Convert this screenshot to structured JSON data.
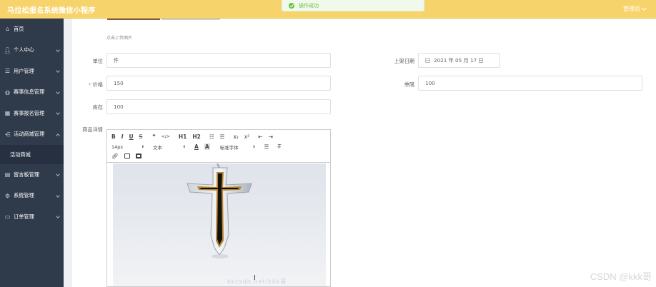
{
  "app": {
    "title": "马拉松报名系统微信小程序",
    "admin": "管理员"
  },
  "toast": {
    "message": "操作成功",
    "color": "#67c23a"
  },
  "colors": {
    "topbar": "#f7d46b",
    "sidebar": "#2f3a4a",
    "accent_red": "#f56c6c"
  },
  "sidebar": {
    "items": [
      {
        "label": "首页",
        "icon": "home-icon",
        "has_children": false
      },
      {
        "label": "个人中心",
        "icon": "user-icon",
        "has_children": true
      },
      {
        "label": "用户管理",
        "icon": "users-icon",
        "has_children": true
      },
      {
        "label": "赛事信息管理",
        "icon": "globe-icon",
        "has_children": true
      },
      {
        "label": "赛事报名管理",
        "icon": "calendar-icon",
        "has_children": true
      },
      {
        "label": "活动商城管理",
        "icon": "share-icon",
        "has_children": true,
        "expanded": true,
        "children": [
          {
            "label": "活动商城"
          }
        ]
      },
      {
        "label": "留言板管理",
        "icon": "message-icon",
        "has_children": true
      },
      {
        "label": "系统管理",
        "icon": "gear-icon",
        "has_children": true
      },
      {
        "label": "订单管理",
        "icon": "monitor-icon",
        "has_children": true
      }
    ]
  },
  "form": {
    "upload_tip": "点击上传图片",
    "unit": {
      "label": "单位",
      "value": "件"
    },
    "shelf_date": {
      "label": "上架日期",
      "value": "2021 年 05 月 17 日"
    },
    "price": {
      "label": "价格",
      "value": "150",
      "required": true
    },
    "limit": {
      "label": "单限",
      "value": "100"
    },
    "stock": {
      "label": "库存",
      "value": "100"
    },
    "details": {
      "label": "商品详情"
    }
  },
  "editor": {
    "toolbar_row1": [
      "B",
      "I",
      "U",
      "S",
      "❞",
      "</>",
      "H1",
      "H2",
      "ol",
      "ul",
      "x₂",
      "x²",
      "outdent",
      "indent"
    ],
    "font_size": "14px",
    "text_format": "文本",
    "font_family": "标准字体",
    "image_alt": "black-and-gold-cross-pendant"
  },
  "watermark": "CSDN @kkk哥",
  "watermark_overlay": "kkcsdn.net/kkk哥"
}
